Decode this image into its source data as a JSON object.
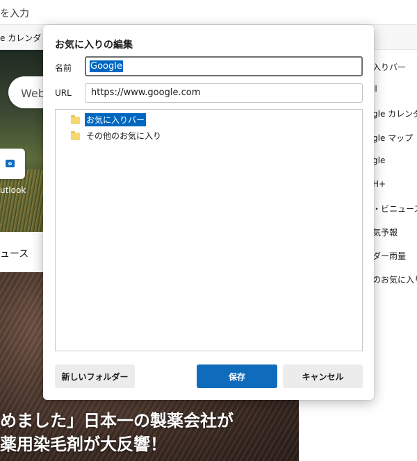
{
  "browser": {
    "address_placeholder": "を入力",
    "favorites_bar_item": "e カレンダ"
  },
  "newtab": {
    "search_text": "Web",
    "tile_label": "utlook",
    "news_label": "ュース",
    "headline_line1": "めました」日本一の製薬会社が",
    "headline_line2": "薬用染毛剤が大反響！"
  },
  "right_panel": {
    "items": [
      "入りバー",
      "il",
      "gle カレンダ",
      "gle マップ",
      "gle",
      "H+",
      "・ビニュース",
      "気予報",
      "ダー雨量",
      "のお気に入り"
    ]
  },
  "dialog": {
    "title": "お気に入りの編集",
    "name_label": "名前",
    "name_value": "Google",
    "url_label": "URL",
    "url_value": "https://www.google.com",
    "folders": [
      {
        "label": "お気に入りバー",
        "selected": true
      },
      {
        "label": "その他のお気に入り",
        "selected": false
      }
    ],
    "new_folder_button": "新しいフォルダー",
    "save_button": "保存",
    "cancel_button": "キャンセル"
  },
  "colors": {
    "accent": "#0f6cbd",
    "selection": "#0067c0",
    "folder": "#f7d774"
  }
}
